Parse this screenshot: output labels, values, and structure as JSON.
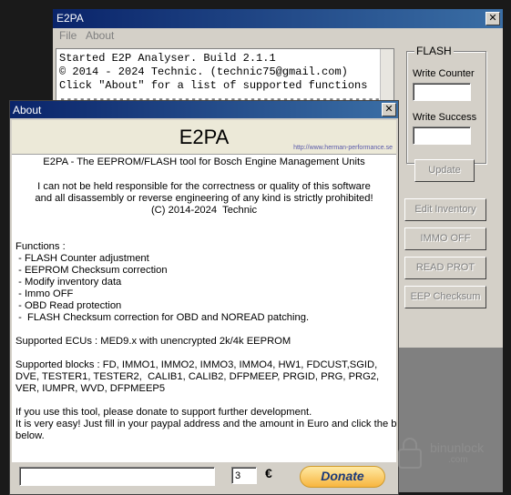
{
  "main_window": {
    "title": "E2PA",
    "close_glyph": "✕",
    "menu": [
      "File",
      "About"
    ],
    "log_lines": [
      "Started E2P Analyser. Build 2.1.1",
      "© 2014 - 2024 Technic. (technic75@gmail.com)",
      "Click \"About\" for a list of supported functions",
      "--------------------------------------------------"
    ],
    "flash": {
      "group_label": "FLASH",
      "write_counter_label": "Write Counter",
      "write_counter_value": "",
      "write_success_label": "Write Success",
      "write_success_value": "",
      "update_label": "Update"
    },
    "buttons": {
      "edit_inventory": "Edit Inventory",
      "immo_off": "IMMO OFF",
      "read_prot": "READ PROT",
      "eep_checksum": "EEP Checksum"
    }
  },
  "about_dialog": {
    "title": "About",
    "close_glyph": "✕",
    "banner_title": "E2PA",
    "banner_url": "http://www.herman-performance.se",
    "lines": [
      "E2PA - The EEPROM/FLASH tool for Bosch Engine Management Units",
      "I can not be held responsible for the correctness or quality of this software",
      "and all disassembly or reverse engineering of any kind is strictly prohibited!",
      "(C) 2014-2024  Technic",
      "Functions :",
      " - FLASH Counter adjustment",
      " - EEPROM Checksum correction",
      " - Modify inventory data",
      " - Immo OFF",
      " - OBD Read protection",
      " -  FLASH Checksum correction for OBD and NOREAD patching.",
      "Supported ECUs : MED9.x with unencrypted 2k/4k EEPROM",
      "Supported blocks : FD, IMMO1, IMMO2, IMMO3, IMMO4, HW1, FDCUST,SGID,",
      "DVE, TESTER1, TESTER2,  CALIB1, CALIB2, DFPMEEP, PRGID, PRG, PRG2,",
      "VER, IUMPR, WVD, DFPMEEP5",
      "If you use this tool, please donate to support further development.",
      "It is very easy! Just fill in your paypal address and the amount in Euro and click the button",
      "below."
    ],
    "donate": {
      "address_value": "",
      "amount_value": "3",
      "currency_symbol": "€",
      "button_label": "Donate"
    }
  },
  "watermark": {
    "text": "binunlock",
    "sub": ".com"
  },
  "colors": {
    "title_bar_start": "#0a246a",
    "title_bar_end": "#3a6ea5",
    "window_face": "#d4d0c8",
    "disabled_text": "#808080"
  }
}
